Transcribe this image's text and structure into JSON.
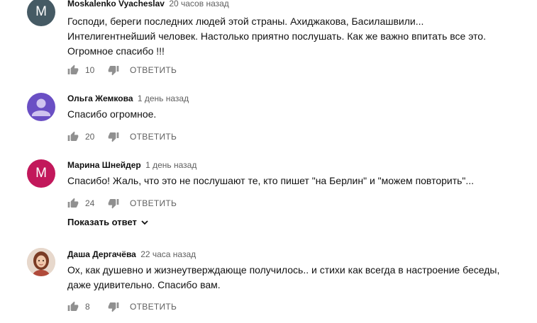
{
  "comments": [
    {
      "author": "Moskalenko Vyacheslav",
      "time": "20 часов назад",
      "avatar_letter": "M",
      "lines": [
        "Господи, береги последних людей этой страны. Ахиджакова, Басилашвили...",
        "Интелигентнейший человек. Настолько приятно послушать. Как же важно впитать все это.",
        "Огромное спасибо !!!"
      ],
      "likes": "10",
      "reply": "ОТВЕТИТЬ"
    },
    {
      "author": "Ольга Жемкова",
      "time": "1 день назад",
      "avatar_icon": "person-icon",
      "lines": [
        "Спасибо огромное."
      ],
      "likes": "20",
      "reply": "ОТВЕТИТЬ"
    },
    {
      "author": "Марина Шнейдер",
      "time": "1 день назад",
      "avatar_letter": "M",
      "lines": [
        "Спасибо! Жаль, что это не послушают те, кто пишет \"на Берлин\" и \"можем повторить\"..."
      ],
      "likes": "24",
      "reply": "ОТВЕТИТЬ",
      "show_replies": "Показать ответ"
    },
    {
      "author": "Даша Дергачёва",
      "time": "22 часа назад",
      "avatar_icon": "user-photo",
      "lines": [
        "Ох, как душевно и жизнеутверждающе получилось.. и стихи как всегда в настроение беседы,",
        "даже удивительно. Спасибо вам."
      ],
      "likes": "8",
      "reply": "ОТВЕТИТЬ"
    }
  ],
  "colors": {
    "text": "#111111",
    "muted": "#606060",
    "avatar_gray": "#455a64",
    "avatar_pink": "#c2185b",
    "avatar_purple": "#6a4fc4"
  }
}
